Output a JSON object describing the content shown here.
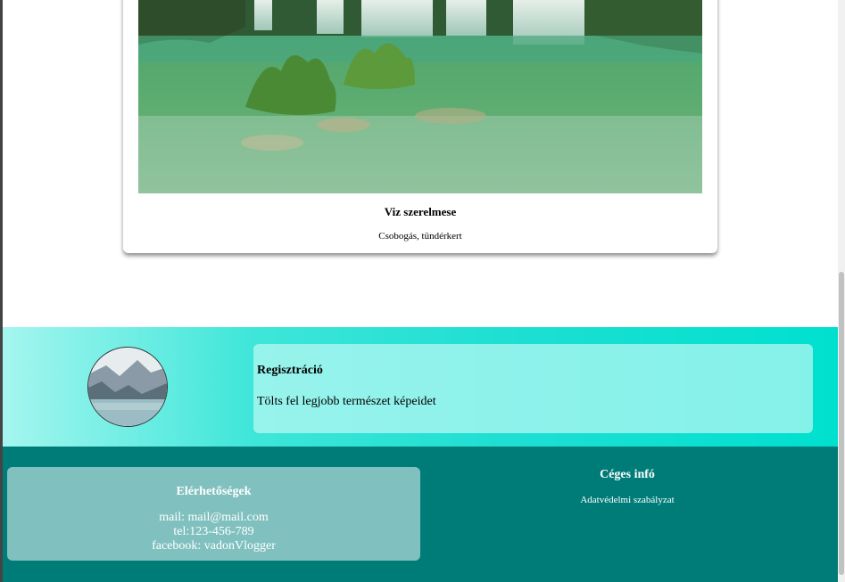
{
  "card": {
    "title": "Viz szerelmese",
    "subtitle": "Csobogás, tündérkert"
  },
  "registration": {
    "title": "Regisztráció",
    "text": "Tölts fel legjobb természet képeidet"
  },
  "contact": {
    "title": "Elérhetőségek",
    "mail": "mail: mail@mail.com",
    "tel": "tel:123-456-789",
    "facebook": "facebook: vadonVlogger"
  },
  "company": {
    "title": "Céges infó",
    "privacy_link": "Adatvédelmi szabályzat"
  },
  "colors": {
    "footer": "#007c78",
    "contact_box": "#80c1bf",
    "band_accent": "#00e0cf"
  }
}
